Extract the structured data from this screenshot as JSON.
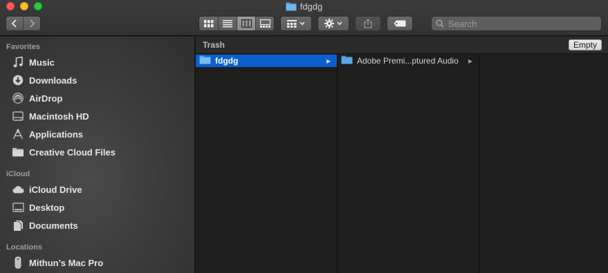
{
  "window": {
    "title": "fdgdg"
  },
  "toolbar": {
    "search_placeholder": "Search"
  },
  "sidebar": {
    "favorites_heading": "Favorites",
    "favorites": [
      {
        "label": "Music",
        "icon": "music-note-icon"
      },
      {
        "label": "Downloads",
        "icon": "downloads-icon"
      },
      {
        "label": "AirDrop",
        "icon": "airdrop-icon"
      },
      {
        "label": "Macintosh HD",
        "icon": "hard-drive-icon"
      },
      {
        "label": "Applications",
        "icon": "applications-icon"
      },
      {
        "label": "Creative Cloud Files",
        "icon": "folder-icon"
      }
    ],
    "icloud_heading": "iCloud",
    "icloud": [
      {
        "label": "iCloud Drive",
        "icon": "cloud-icon"
      },
      {
        "label": "Desktop",
        "icon": "desktop-icon"
      },
      {
        "label": "Documents",
        "icon": "documents-icon"
      }
    ],
    "locations_heading": "Locations",
    "locations": [
      {
        "label": "Mithun’s Mac Pro",
        "icon": "mac-pro-icon"
      }
    ]
  },
  "pathbar": {
    "location": "Trash",
    "empty_button": "Empty"
  },
  "columns": {
    "col1": [
      {
        "name": "fdgdg",
        "selected": true,
        "has_children": true
      }
    ],
    "col2": [
      {
        "name": "Adobe Premi...ptured Audio",
        "selected": false,
        "has_children": true
      }
    ]
  },
  "colors": {
    "selection": "#0b5fd0",
    "folder": "#5aa9e6"
  }
}
